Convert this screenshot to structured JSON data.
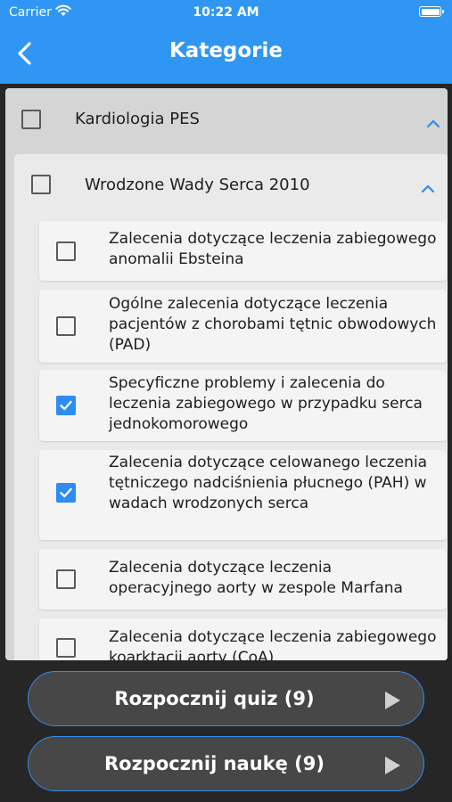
{
  "status_bar": {
    "carrier": "Carrier",
    "time": "10:22 AM"
  },
  "header": {
    "title": "Kategorie"
  },
  "category": {
    "label": "Kardiologia PES",
    "checked": false
  },
  "subcategory": {
    "label": "Wrodzone Wady Serca 2010",
    "checked": false
  },
  "items": [
    {
      "label": " Zalecenia dotyczące leczenia zabiegowego anomalii Ebsteina",
      "checked": false
    },
    {
      "label": "Ogólne zalecenia dotyczące leczenia pacjentów z chorobami tętnic obwodowych (PAD)",
      "checked": false
    },
    {
      "label": "Specyficzne problemy i zalecenia do leczenia zabiegowego w przypadku serca jednokomorowego",
      "checked": true
    },
    {
      "label": "Zalecenia dotyczące celowanego leczenia tętniczego nadciśnienia płucnego (PAH) w wadach wrodzonych serca",
      "checked": true
    },
    {
      "label": "Zalecenia dotyczące leczenia operacyjnego aorty w zespole Marfana",
      "checked": false
    },
    {
      "label": "Zalecenia dotyczące leczenia zabiegowego koarktacji aorty (CoA)",
      "checked": false
    }
  ],
  "buttons": {
    "quiz": "Rozpocznij quiz (9)",
    "learn": "Rozpocznij naukę (9)"
  },
  "colors": {
    "header": "#2F97F3",
    "accent": "#2F8CF1",
    "background": "#262626"
  }
}
